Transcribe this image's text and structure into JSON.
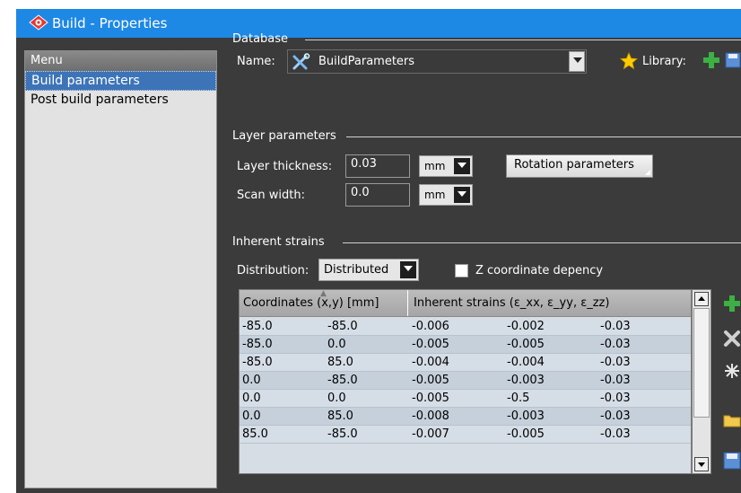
{
  "window": {
    "title": "Build - Properties"
  },
  "menu": {
    "header": "Menu",
    "items": [
      {
        "label": "Build parameters",
        "selected": true
      },
      {
        "label": "Post build parameters",
        "selected": false
      }
    ]
  },
  "database": {
    "section_title": "Database",
    "name_label": "Name:",
    "name_value": "BuildParameters",
    "library_label": "Library:"
  },
  "layer": {
    "section_title": "Layer parameters",
    "thickness_label": "Layer thickness:",
    "thickness_value": "0.03",
    "thickness_unit": "mm",
    "scan_label": "Scan width:",
    "scan_value": "0.0",
    "scan_unit": "mm",
    "rotation_button": "Rotation parameters"
  },
  "strains": {
    "section_title": "Inherent strains",
    "distribution_label": "Distribution:",
    "distribution_value": "Distributed",
    "zcoord_label": "Z coordinate depency",
    "columns": [
      "Coordinates (x,y) [mm]",
      "Inherent strains (ε_xx, ε_yy, ε_zz)"
    ],
    "rows": [
      [
        "-85.0",
        "-85.0",
        "-0.006",
        "-0.002",
        "-0.03"
      ],
      [
        "-85.0",
        "0.0",
        "-0.005",
        "-0.005",
        "-0.03"
      ],
      [
        "-85.0",
        "85.0",
        "-0.004",
        "-0.004",
        "-0.03"
      ],
      [
        "0.0",
        "-85.0",
        "-0.005",
        "-0.003",
        "-0.03"
      ],
      [
        "0.0",
        "0.0",
        "-0.005",
        "-0.5",
        "-0.03"
      ],
      [
        "0.0",
        "85.0",
        "-0.008",
        "-0.003",
        "-0.03"
      ],
      [
        "85.0",
        "-85.0",
        "-0.007",
        "-0.005",
        "-0.03"
      ]
    ]
  },
  "colors": {
    "titlebar": "#1e88e5",
    "background": "#3b3b3b",
    "menu_selected": "#3d74b7",
    "add_green": "#3cb043"
  }
}
